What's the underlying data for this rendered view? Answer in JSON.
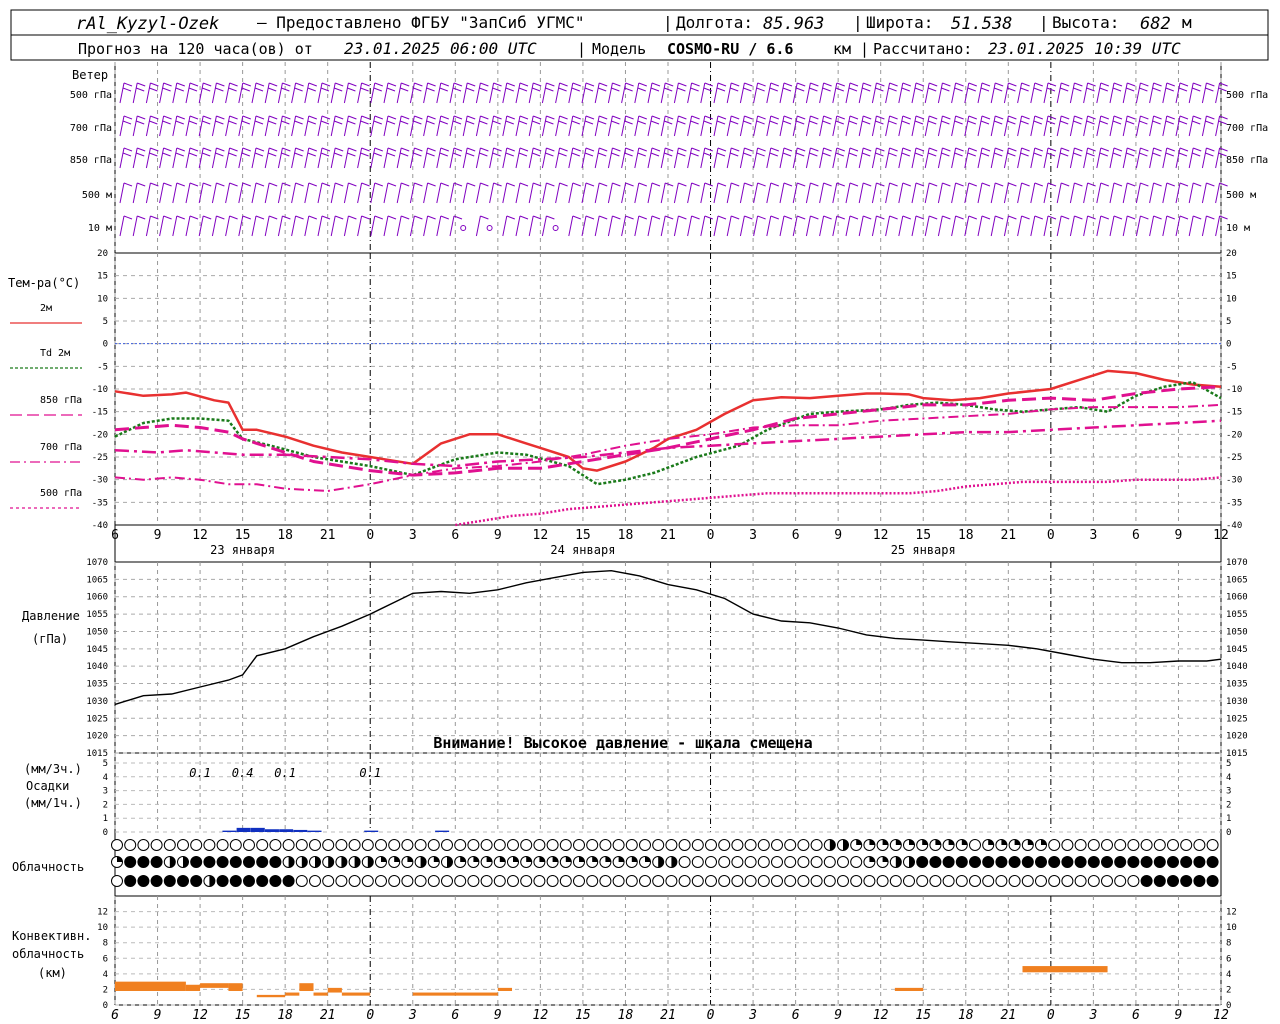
{
  "header": {
    "station": "rAl_Kyzyl-Ozek",
    "provider": "— Предоставлено ФГБУ \"ЗапСиб УГМС\"",
    "lon_label": "Долгота:",
    "lon_value": "85.963",
    "lat_label": "Широта:",
    "lat_value": "51.538",
    "alt_label": "Высота:",
    "alt_value": "682",
    "alt_unit": "м",
    "forecast_label": "Прогноз на 120 часа(ов) от",
    "forecast_start": "23.01.2025 06:00 UTC",
    "model_label": "Модель",
    "model_name": "COSMO-RU / 6.6",
    "model_unit": "км",
    "calc_label": "Рассчитано:",
    "calc_time": "23.01.2025 10:39 UTC"
  },
  "time_axis": {
    "hour_labels": [
      "6",
      "9",
      "12",
      "15",
      "18",
      "21",
      "0",
      "3",
      "6",
      "9",
      "12",
      "15",
      "18",
      "21",
      "0",
      "3",
      "6",
      "9",
      "12",
      "15",
      "18",
      "21",
      "0",
      "3",
      "6",
      "9",
      "12"
    ],
    "day_labels": [
      "23 января",
      "24 января",
      "25 января"
    ]
  },
  "wind_panel": {
    "title": "Ветер",
    "levels": [
      "500 гПа",
      "700 гПа",
      "850 гПа",
      "500 м",
      "10  м"
    ],
    "color": "#8000c0"
  },
  "temp_panel": {
    "title": "Тем-ра(°С)",
    "legend": [
      {
        "label": "2м",
        "color": "#e83030"
      },
      {
        "label": "Td  2м",
        "color": "#1a7a1a"
      },
      {
        "label": "850 гПа",
        "color": "#e01090"
      },
      {
        "label": "700 гПа",
        "color": "#e01090"
      },
      {
        "label": "500 гПа",
        "color": "#e01090"
      }
    ],
    "ticks": [
      "20",
      "15",
      "10",
      "5",
      "0",
      "-5",
      "-10",
      "-15",
      "-20",
      "-25",
      "-30",
      "-35",
      "-40"
    ]
  },
  "pressure_panel": {
    "title": "Давление",
    "unit": "(гПа)",
    "ticks": [
      "1070",
      "1065",
      "1060",
      "1055",
      "1050",
      "1045",
      "1040",
      "1035",
      "1030",
      "1025",
      "1020",
      "1015"
    ],
    "warning": "Внимание! Высокое давление - шкала смещена"
  },
  "precip_panel": {
    "title_top": "(мм/3ч.)",
    "title_mid": "Осадки",
    "title_bot": "(мм/1ч.)",
    "ticks": [
      "5",
      "4",
      "3",
      "2",
      "1",
      "0"
    ],
    "annotations": [
      {
        "text": "0.1",
        "hour": 12
      },
      {
        "text": "0.4",
        "hour": 15
      },
      {
        "text": "0.1",
        "hour": 18
      },
      {
        "text": "0.1",
        "hour": 24
      }
    ]
  },
  "cloud_panel": {
    "title": "Облачность"
  },
  "conv_panel": {
    "title_1": "Конвективн.",
    "title_2": "облачность",
    "title_3": "(км)",
    "ticks": [
      "12",
      "10",
      "8",
      "6",
      "4",
      "2",
      "0"
    ]
  },
  "chart_data": [
    {
      "type": "line",
      "title": "Тем-ра(°С)",
      "x_unit": "hours from 23.01.2025 00:00 UTC",
      "xlim": [
        6,
        84
      ],
      "ylim": [
        -40,
        20
      ],
      "grid": true,
      "series": [
        {
          "name": "2м",
          "color": "#e83030",
          "style": "solid",
          "x": [
            6,
            8,
            10,
            11,
            13,
            14,
            15,
            16,
            18,
            20,
            22,
            24,
            27,
            29,
            31,
            33,
            35,
            36,
            38,
            39,
            40,
            42,
            44,
            45,
            47,
            49,
            51,
            53,
            55,
            57,
            59,
            60,
            62,
            63,
            65,
            67,
            69,
            72,
            74,
            76,
            78,
            80,
            82,
            84
          ],
          "y": [
            -10.5,
            -11.5,
            -11.2,
            -10.8,
            -12.5,
            -13,
            -19,
            -19,
            -20.5,
            -22.5,
            -24,
            -25,
            -26.5,
            -22,
            -20,
            -20,
            -22,
            -23,
            -25,
            -27.5,
            -28,
            -26,
            -23,
            -21,
            -19,
            -15.5,
            -12.5,
            -11.8,
            -12,
            -11.5,
            -11,
            -11,
            -11.2,
            -12,
            -12.5,
            -12,
            -11,
            -10,
            -8,
            -6,
            -6.5,
            -8,
            -9,
            -9.5
          ]
        },
        {
          "name": "Td 2м",
          "color": "#1a7a1a",
          "style": "dotted",
          "x": [
            6,
            8,
            10,
            12,
            14,
            15,
            17,
            20,
            24,
            27,
            30,
            33,
            35,
            38,
            40,
            42,
            44,
            47,
            50,
            52,
            55,
            57,
            60,
            62,
            64,
            66,
            68,
            70,
            72,
            74,
            76,
            78,
            80,
            82,
            84
          ],
          "y": [
            -20.5,
            -17.5,
            -16.5,
            -16.5,
            -17,
            -21,
            -22.5,
            -25,
            -27,
            -29,
            -25.5,
            -24,
            -24.5,
            -27,
            -31,
            -30,
            -28.5,
            -25,
            -22.5,
            -19,
            -15.5,
            -15,
            -14.5,
            -13.5,
            -13,
            -13.5,
            -14.5,
            -15,
            -14.5,
            -14,
            -15,
            -11.5,
            -9.5,
            -8.5,
            -12
          ]
        },
        {
          "name": "850 гПа",
          "color": "#e01090",
          "style": "dashed",
          "x": [
            6,
            8,
            10,
            12,
            14,
            15,
            17,
            20,
            24,
            27,
            30,
            33,
            36,
            39,
            42,
            45,
            48,
            51,
            54,
            57,
            60,
            63,
            66,
            69,
            72,
            75,
            78,
            81,
            84
          ],
          "y": [
            -19,
            -18.5,
            -18,
            -18.5,
            -19.5,
            -21,
            -23,
            -26,
            -28,
            -29,
            -28.5,
            -27.5,
            -27.5,
            -26,
            -24.5,
            -23,
            -21,
            -19,
            -16.5,
            -15.5,
            -14.5,
            -13.5,
            -13.5,
            -12.5,
            -12,
            -12.5,
            -11,
            -10,
            -9.5
          ]
        },
        {
          "name": "700 гПа",
          "color": "#e01090",
          "style": "dashdot",
          "x": [
            6,
            9,
            11,
            13,
            15,
            18,
            21,
            24,
            27,
            30,
            33,
            36,
            39,
            42,
            45,
            48,
            51,
            54,
            57,
            60,
            63,
            66,
            69,
            72,
            75,
            78,
            81,
            84
          ],
          "y": [
            -23.5,
            -24,
            -23.5,
            -24,
            -24.5,
            -24.5,
            -25,
            -25.5,
            -26.5,
            -27,
            -26,
            -25.5,
            -25,
            -24,
            -23,
            -22.5,
            -22,
            -21.5,
            -21,
            -20.5,
            -20,
            -19.5,
            -19.5,
            -19,
            -18.5,
            -18,
            -17.5,
            -17
          ]
        },
        {
          "name": "500 гПа",
          "color": "#e01090",
          "style": "dashdot-thin",
          "x": [
            6,
            8,
            10,
            12,
            14,
            16,
            18,
            21,
            24,
            27,
            30,
            33,
            36,
            39,
            42,
            45,
            48,
            51,
            54,
            57,
            60,
            63,
            66,
            69,
            72,
            75,
            78,
            81,
            84
          ],
          "y": [
            -29.5,
            -30,
            -29.5,
            -30,
            -31,
            -31,
            -32,
            -32.5,
            -31,
            -29,
            -27.5,
            -27,
            -26,
            -24.5,
            -22.5,
            -21,
            -20,
            -18.5,
            -18,
            -18,
            -17,
            -16.5,
            -16,
            -15.5,
            -14.5,
            -14,
            -14,
            -14,
            -13.5
          ]
        },
        {
          "name": "500 гПа",
          "color": "#e01090",
          "style": "dotted-lower",
          "x": [
            30,
            32,
            34,
            36,
            38,
            40,
            42,
            44,
            46,
            48,
            50,
            52,
            54,
            56,
            58,
            60,
            62,
            64,
            66,
            68,
            70,
            72,
            74,
            76,
            78,
            80,
            82,
            84
          ],
          "y": [
            -40,
            -39,
            -38,
            -37.5,
            -36.5,
            -36,
            -35.5,
            -35,
            -34.5,
            -34,
            -33.5,
            -33,
            -33,
            -33,
            -33,
            -33,
            -33,
            -32.5,
            -31.5,
            -31,
            -30.5,
            -30.5,
            -30.5,
            -30.5,
            -30,
            -30,
            -30,
            -29.5
          ]
        }
      ]
    },
    {
      "type": "line",
      "title": "Давление",
      "ylabel": "(гПа)",
      "xlim": [
        6,
        84
      ],
      "ylim": [
        1015,
        1070
      ],
      "series": [
        {
          "name": "Давление",
          "color": "#000000",
          "x": [
            6,
            8,
            10,
            12,
            14,
            15,
            16,
            18,
            20,
            22,
            24,
            26,
            27,
            29,
            31,
            33,
            35,
            37,
            39,
            41,
            43,
            45,
            47,
            49,
            51,
            53,
            55,
            57,
            59,
            61,
            63,
            65,
            67,
            69,
            71,
            73,
            75,
            77,
            79,
            81,
            83,
            84
          ],
          "y": [
            1029,
            1031.5,
            1032,
            1034,
            1036,
            1037.5,
            1043,
            1045,
            1048.5,
            1051.5,
            1055,
            1059,
            1061,
            1061.5,
            1061,
            1062,
            1064,
            1065.5,
            1067,
            1067.5,
            1066,
            1063.5,
            1062,
            1059.5,
            1055,
            1053,
            1052.5,
            1051,
            1049,
            1048,
            1047.5,
            1047,
            1046.5,
            1046,
            1045,
            1043.5,
            1042,
            1041,
            1041,
            1041.5,
            1041.5,
            1042
          ]
        }
      ]
    },
    {
      "type": "bar",
      "title": "Осадки",
      "ylabel": "(мм/1ч.)",
      "ylim": [
        0,
        5
      ],
      "x": [
        14,
        15,
        16,
        17,
        18,
        19,
        20,
        24,
        29
      ],
      "values": [
        0.1,
        0.3,
        0.3,
        0.2,
        0.2,
        0.15,
        0.1,
        0.1,
        0.1
      ],
      "color": "#1030c0"
    },
    {
      "type": "bar",
      "title": "Конвективн. облачность",
      "ylabel": "(км)",
      "ylim": [
        0,
        14
      ],
      "segments": [
        {
          "x0": 6,
          "x1": 11,
          "bottom": 1.8,
          "top": 3.0
        },
        {
          "x0": 11,
          "x1": 12,
          "bottom": 1.8,
          "top": 2.6
        },
        {
          "x0": 12,
          "x1": 14,
          "bottom": 2.2,
          "top": 2.8
        },
        {
          "x0": 14,
          "x1": 15,
          "bottom": 1.8,
          "top": 2.8
        },
        {
          "x0": 16,
          "x1": 18,
          "bottom": 1.0,
          "top": 1.3
        },
        {
          "x0": 18,
          "x1": 19,
          "bottom": 1.2,
          "top": 1.6
        },
        {
          "x0": 19,
          "x1": 20,
          "bottom": 1.8,
          "top": 2.8
        },
        {
          "x0": 20,
          "x1": 21,
          "bottom": 1.2,
          "top": 1.6
        },
        {
          "x0": 21,
          "x1": 22,
          "bottom": 1.6,
          "top": 2.2
        },
        {
          "x0": 22,
          "x1": 24,
          "bottom": 1.2,
          "top": 1.6
        },
        {
          "x0": 27,
          "x1": 33,
          "bottom": 1.2,
          "top": 1.6
        },
        {
          "x0": 33,
          "x1": 34,
          "bottom": 1.8,
          "top": 2.2
        },
        {
          "x0": 61,
          "x1": 63,
          "bottom": 1.8,
          "top": 2.2
        },
        {
          "x0": 70,
          "x1": 76,
          "bottom": 4.2,
          "top": 5.0
        }
      ],
      "color": "#f08020"
    }
  ]
}
